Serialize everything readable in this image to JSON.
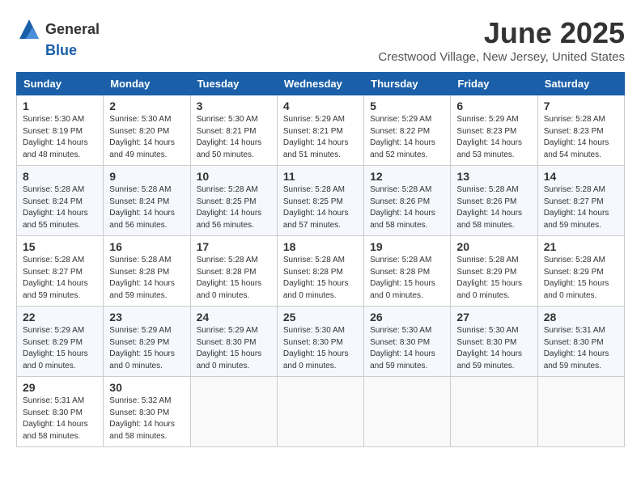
{
  "header": {
    "logo_general": "General",
    "logo_blue": "Blue",
    "month_title": "June 2025",
    "location": "Crestwood Village, New Jersey, United States"
  },
  "weekdays": [
    "Sunday",
    "Monday",
    "Tuesday",
    "Wednesday",
    "Thursday",
    "Friday",
    "Saturday"
  ],
  "weeks": [
    [
      {
        "day": "1",
        "sunrise": "5:30 AM",
        "sunset": "8:19 PM",
        "daylight": "14 hours and 48 minutes."
      },
      {
        "day": "2",
        "sunrise": "5:30 AM",
        "sunset": "8:20 PM",
        "daylight": "14 hours and 49 minutes."
      },
      {
        "day": "3",
        "sunrise": "5:30 AM",
        "sunset": "8:21 PM",
        "daylight": "14 hours and 50 minutes."
      },
      {
        "day": "4",
        "sunrise": "5:29 AM",
        "sunset": "8:21 PM",
        "daylight": "14 hours and 51 minutes."
      },
      {
        "day": "5",
        "sunrise": "5:29 AM",
        "sunset": "8:22 PM",
        "daylight": "14 hours and 52 minutes."
      },
      {
        "day": "6",
        "sunrise": "5:29 AM",
        "sunset": "8:23 PM",
        "daylight": "14 hours and 53 minutes."
      },
      {
        "day": "7",
        "sunrise": "5:28 AM",
        "sunset": "8:23 PM",
        "daylight": "14 hours and 54 minutes."
      }
    ],
    [
      {
        "day": "8",
        "sunrise": "5:28 AM",
        "sunset": "8:24 PM",
        "daylight": "14 hours and 55 minutes."
      },
      {
        "day": "9",
        "sunrise": "5:28 AM",
        "sunset": "8:24 PM",
        "daylight": "14 hours and 56 minutes."
      },
      {
        "day": "10",
        "sunrise": "5:28 AM",
        "sunset": "8:25 PM",
        "daylight": "14 hours and 56 minutes."
      },
      {
        "day": "11",
        "sunrise": "5:28 AM",
        "sunset": "8:25 PM",
        "daylight": "14 hours and 57 minutes."
      },
      {
        "day": "12",
        "sunrise": "5:28 AM",
        "sunset": "8:26 PM",
        "daylight": "14 hours and 58 minutes."
      },
      {
        "day": "13",
        "sunrise": "5:28 AM",
        "sunset": "8:26 PM",
        "daylight": "14 hours and 58 minutes."
      },
      {
        "day": "14",
        "sunrise": "5:28 AM",
        "sunset": "8:27 PM",
        "daylight": "14 hours and 59 minutes."
      }
    ],
    [
      {
        "day": "15",
        "sunrise": "5:28 AM",
        "sunset": "8:27 PM",
        "daylight": "14 hours and 59 minutes."
      },
      {
        "day": "16",
        "sunrise": "5:28 AM",
        "sunset": "8:28 PM",
        "daylight": "14 hours and 59 minutes."
      },
      {
        "day": "17",
        "sunrise": "5:28 AM",
        "sunset": "8:28 PM",
        "daylight": "15 hours and 0 minutes."
      },
      {
        "day": "18",
        "sunrise": "5:28 AM",
        "sunset": "8:28 PM",
        "daylight": "15 hours and 0 minutes."
      },
      {
        "day": "19",
        "sunrise": "5:28 AM",
        "sunset": "8:28 PM",
        "daylight": "15 hours and 0 minutes."
      },
      {
        "day": "20",
        "sunrise": "5:28 AM",
        "sunset": "8:29 PM",
        "daylight": "15 hours and 0 minutes."
      },
      {
        "day": "21",
        "sunrise": "5:28 AM",
        "sunset": "8:29 PM",
        "daylight": "15 hours and 0 minutes."
      }
    ],
    [
      {
        "day": "22",
        "sunrise": "5:29 AM",
        "sunset": "8:29 PM",
        "daylight": "15 hours and 0 minutes."
      },
      {
        "day": "23",
        "sunrise": "5:29 AM",
        "sunset": "8:29 PM",
        "daylight": "15 hours and 0 minutes."
      },
      {
        "day": "24",
        "sunrise": "5:29 AM",
        "sunset": "8:30 PM",
        "daylight": "15 hours and 0 minutes."
      },
      {
        "day": "25",
        "sunrise": "5:30 AM",
        "sunset": "8:30 PM",
        "daylight": "15 hours and 0 minutes."
      },
      {
        "day": "26",
        "sunrise": "5:30 AM",
        "sunset": "8:30 PM",
        "daylight": "14 hours and 59 minutes."
      },
      {
        "day": "27",
        "sunrise": "5:30 AM",
        "sunset": "8:30 PM",
        "daylight": "14 hours and 59 minutes."
      },
      {
        "day": "28",
        "sunrise": "5:31 AM",
        "sunset": "8:30 PM",
        "daylight": "14 hours and 59 minutes."
      }
    ],
    [
      {
        "day": "29",
        "sunrise": "5:31 AM",
        "sunset": "8:30 PM",
        "daylight": "14 hours and 58 minutes."
      },
      {
        "day": "30",
        "sunrise": "5:32 AM",
        "sunset": "8:30 PM",
        "daylight": "14 hours and 58 minutes."
      },
      null,
      null,
      null,
      null,
      null
    ]
  ]
}
